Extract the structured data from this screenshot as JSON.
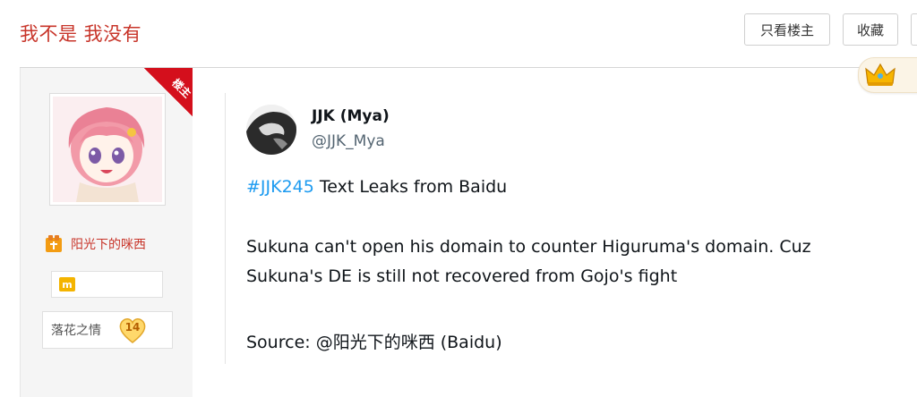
{
  "thread": {
    "title": "我不是 我没有",
    "buttons": {
      "only_op": "只看楼主",
      "favorite": "收藏"
    }
  },
  "author": {
    "op_tag": "楼主",
    "username": "阳光下的咪西",
    "badge_letter": "m",
    "level_name": "落花之情",
    "level": "14"
  },
  "tweet": {
    "display_name": "JJK (Mya)",
    "handle": "@JJK_Mya",
    "hashtag": "#JJK245",
    "headline_rest": " Text Leaks from Baidu",
    "body_line1": "Sukuna can't open his domain to counter Higuruma's domain. Cuz",
    "body_line2": "Sukuna's DE is still not recovered from Gojo's fight",
    "source": "Source: @阳光下的咪西 (Baidu)"
  },
  "colors": {
    "title_red": "#c8352a",
    "ribbon_red": "#d40f1c",
    "hashtag_blue": "#1d9bf0"
  },
  "icons": [
    "user-level-icon",
    "member-badge-icon",
    "level-heart-icon",
    "crown-icon"
  ]
}
